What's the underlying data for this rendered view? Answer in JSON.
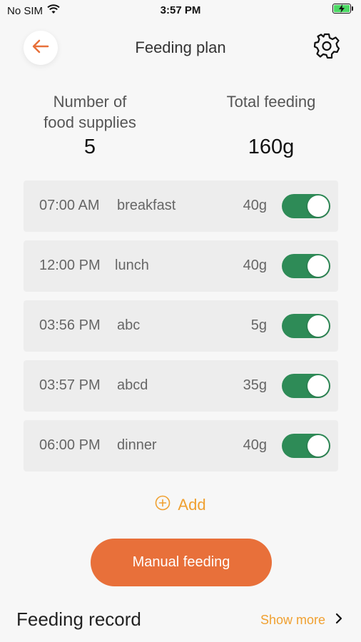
{
  "status_bar": {
    "carrier": "No SIM",
    "time": "3:57 PM",
    "icons": [
      "wifi-icon",
      "battery-charging-icon"
    ]
  },
  "header": {
    "title": "Feeding plan",
    "back_icon": "arrow-left-icon",
    "settings_icon": "gear-icon"
  },
  "summary": {
    "supplies_label_line1": "Number of",
    "supplies_label_line2": "food supplies",
    "supplies_value": "5",
    "total_label": "Total feeding",
    "total_value": "160g"
  },
  "plans": [
    {
      "time": "07:00 AM",
      "name": "breakfast",
      "amount": "40g",
      "enabled": true
    },
    {
      "time": "12:00 PM",
      "name": "lunch",
      "amount": "40g",
      "enabled": true
    },
    {
      "time": "03:56 PM",
      "name": "abc",
      "amount": "5g",
      "enabled": true
    },
    {
      "time": "03:57 PM",
      "name": "abcd",
      "amount": "35g",
      "enabled": true
    },
    {
      "time": "06:00 PM",
      "name": "dinner",
      "amount": "40g",
      "enabled": true
    }
  ],
  "add": {
    "label": "Add",
    "icon": "plus-circle-icon"
  },
  "manual_feeding": {
    "label": "Manual feeding"
  },
  "record": {
    "title": "Feeding record",
    "show_more": "Show more",
    "icon": "chevron-right-icon"
  },
  "colors": {
    "accent_orange": "#e8703a",
    "link_orange": "#f0a030",
    "toggle_green": "#2e8b57",
    "background": "#f7f7f7",
    "row_background": "#ededed"
  }
}
